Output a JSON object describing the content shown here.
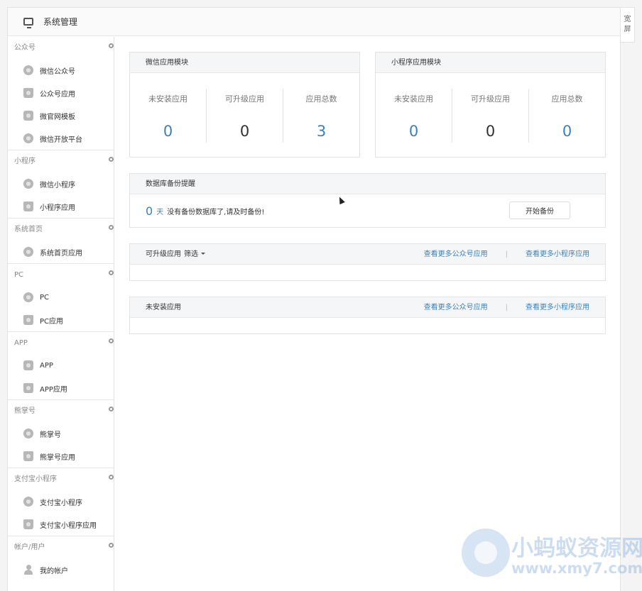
{
  "topbar": {
    "title": "系统管理"
  },
  "widescreen": {
    "line1": "宽",
    "line2": "屏"
  },
  "sidebar": {
    "groups": [
      {
        "title": "公众号",
        "items": [
          {
            "label": "微信公众号",
            "icon": "wechat-icon"
          },
          {
            "label": "公众号应用",
            "icon": "app-bag-icon"
          },
          {
            "label": "微官网模板",
            "icon": "template-icon"
          },
          {
            "label": "微信开放平台",
            "icon": "open-platform-icon"
          }
        ]
      },
      {
        "title": "小程序",
        "items": [
          {
            "label": "微信小程序",
            "icon": "mini-program-icon"
          },
          {
            "label": "小程序应用",
            "icon": "app-bag-icon"
          }
        ]
      },
      {
        "title": "系统首页",
        "items": [
          {
            "label": "系统首页应用",
            "icon": "mini-program-icon"
          }
        ]
      },
      {
        "title": "PC",
        "items": [
          {
            "label": "PC",
            "icon": "pc-icon"
          },
          {
            "label": "PC应用",
            "icon": "app-bag-icon"
          }
        ]
      },
      {
        "title": "APP",
        "items": [
          {
            "label": "APP",
            "icon": "phone-icon"
          },
          {
            "label": "APP应用",
            "icon": "app-bag-icon"
          }
        ]
      },
      {
        "title": "熊掌号",
        "items": [
          {
            "label": "熊掌号",
            "icon": "paw-icon"
          },
          {
            "label": "熊掌号应用",
            "icon": "app-bag-icon"
          }
        ]
      },
      {
        "title": "支付宝小程序",
        "items": [
          {
            "label": "支付宝小程序",
            "icon": "alipay-icon"
          },
          {
            "label": "支付宝小程序应用",
            "icon": "app-bag-icon"
          }
        ]
      },
      {
        "title": "帐户/用户",
        "items": [
          {
            "label": "我的帐户",
            "icon": "user-icon"
          }
        ]
      }
    ]
  },
  "wechat_module": {
    "title": "微信应用模块",
    "stats": [
      {
        "label": "未安装应用",
        "value": "0"
      },
      {
        "label": "可升级应用",
        "value": "0"
      },
      {
        "label": "应用总数",
        "value": "3"
      }
    ]
  },
  "mini_module": {
    "title": "小程序应用模块",
    "stats": [
      {
        "label": "未安装应用",
        "value": "0"
      },
      {
        "label": "可升级应用",
        "value": "0"
      },
      {
        "label": "应用总数",
        "value": "0"
      }
    ]
  },
  "backup": {
    "title": "数据库备份提醒",
    "days": "0",
    "unit": "天",
    "message": "没有备份数据库了,请及时备份!",
    "button": "开始备份"
  },
  "upgradable": {
    "title": "可升级应用",
    "filter": "筛选",
    "link_official": "查看更多公众号应用",
    "separator": "|",
    "link_mini": "查看更多小程序应用"
  },
  "uninstalled": {
    "title": "未安装应用",
    "link_official": "查看更多公众号应用",
    "separator": "|",
    "link_mini": "查看更多小程序应用"
  },
  "watermark": {
    "cn": "小蚂蚁资源网",
    "en": "www.xmy7.com"
  },
  "colors": {
    "accent": "#3b82b9",
    "border": "#e3e3e3",
    "header_bg": "#f5f6f8"
  }
}
